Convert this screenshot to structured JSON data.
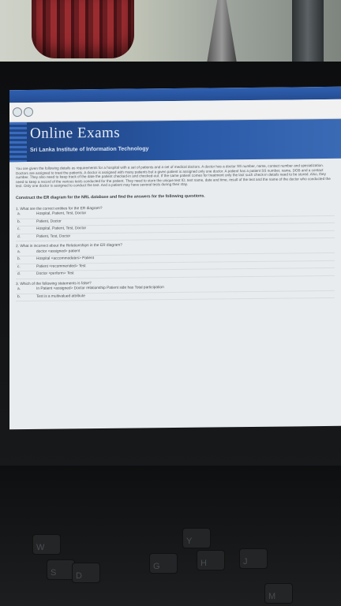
{
  "browser": {
    "title": "Online Exams",
    "subtitle": "Sri Lanka Institute of Information Technology"
  },
  "scenario": "You are given the following details as requirements for a hospital with a set of patients and a set of medical doctors. A doctor has a doctor SS number, name, contact number and specialization. Doctors are assigned to treat the patients. A doctor is assigned with many patients but a given patient is assigned only one doctor. A patient has a patient SS number, name, DOB and a contact number. They also need to keep track of the date the patient checked-in and checked-out. If the same patient comes for treatment only the last such check-in details need to be stored. Also, they need to keep a record of the various tests conducted for the patient. They need to store the unique test ID, test name, date and time, result of the test and the name of the doctor who conducted the test. Only one doctor is assigned to conduct the test. And a patient may have several tests during their stay.",
  "instruction": "Construct the ER diagram for the NRL database and find the answers for the following questions.",
  "questions": [
    {
      "text": "1. What are the correct entities for the ER diagram?",
      "options": [
        {
          "letter": "a.",
          "text": "Hospital, Patient, Test, Doctor"
        },
        {
          "letter": "b.",
          "text": "Patient, Doctor"
        },
        {
          "letter": "c.",
          "text": "Hospital, Patient, Test, Doctor"
        },
        {
          "letter": "d.",
          "text": "Patient, Test, Doctor"
        }
      ]
    },
    {
      "text": "2. What is incorrect about the Relationships in the ER diagram?",
      "options": [
        {
          "letter": "a.",
          "text": "doctor <assigned> patient"
        },
        {
          "letter": "b.",
          "text": "Hospital <accommodates> Patient"
        },
        {
          "letter": "c.",
          "text": "Patient <recommended> Test"
        },
        {
          "letter": "d.",
          "text": "Doctor <perform> Test"
        }
      ]
    },
    {
      "text": "3. Which of the following statements is false?",
      "options": [
        {
          "letter": "a.",
          "text": "In Patient <assigned> Doctor relationship Patient side has Total participation"
        },
        {
          "letter": "b.",
          "text": "Test is a multivalued attribute"
        }
      ]
    }
  ],
  "keyboard": {
    "keys": [
      "W",
      "S",
      "D",
      "G",
      "H",
      "J",
      "M",
      "Y"
    ]
  }
}
